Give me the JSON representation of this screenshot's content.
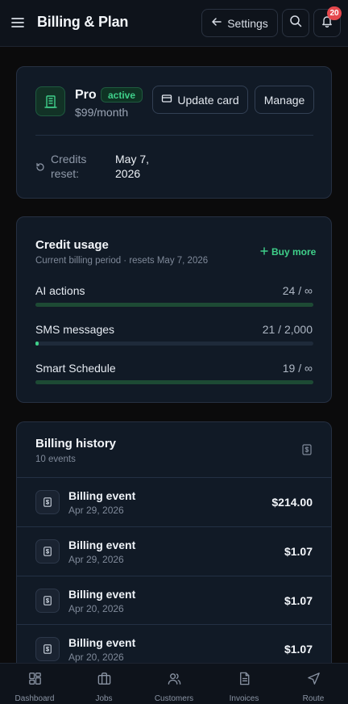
{
  "header": {
    "title": "Billing & Plan",
    "settings_label": "Settings",
    "notification_count": "20"
  },
  "plan": {
    "name": "Pro",
    "status": "active",
    "price": "$99/month",
    "update_card_label": "Update card",
    "manage_label": "Manage",
    "credits_reset_label": "Credits reset:",
    "credits_reset_value": "May 7, 2026",
    "accent_color": "#3fd08a"
  },
  "usage": {
    "title": "Credit usage",
    "subtitle": "Current billing period · resets May 7, 2026",
    "buy_more_label": "Buy more",
    "items": [
      {
        "label": "AI actions",
        "value": "24 / ∞",
        "fill_fraction": 1.0
      },
      {
        "label": "SMS messages",
        "value": "21 / 2,000",
        "fill_fraction": 0.0105
      },
      {
        "label": "Smart Schedule",
        "value": "19 / ∞",
        "fill_fraction": 1.0
      }
    ]
  },
  "history": {
    "title": "Billing history",
    "count_text": "10 events",
    "rows": [
      {
        "title": "Billing event",
        "date": "Apr 29, 2026",
        "amount": "$214.00"
      },
      {
        "title": "Billing event",
        "date": "Apr 29, 2026",
        "amount": "$1.07"
      },
      {
        "title": "Billing event",
        "date": "Apr 20, 2026",
        "amount": "$1.07"
      },
      {
        "title": "Billing event",
        "date": "Apr 20, 2026",
        "amount": "$1.07"
      }
    ]
  },
  "nav": {
    "items": [
      {
        "label": "Dashboard",
        "icon": "dashboard-icon"
      },
      {
        "label": "Jobs",
        "icon": "briefcase-icon"
      },
      {
        "label": "Customers",
        "icon": "users-icon"
      },
      {
        "label": "Invoices",
        "icon": "file-text-icon"
      },
      {
        "label": "Route",
        "icon": "navigation-icon"
      }
    ]
  }
}
